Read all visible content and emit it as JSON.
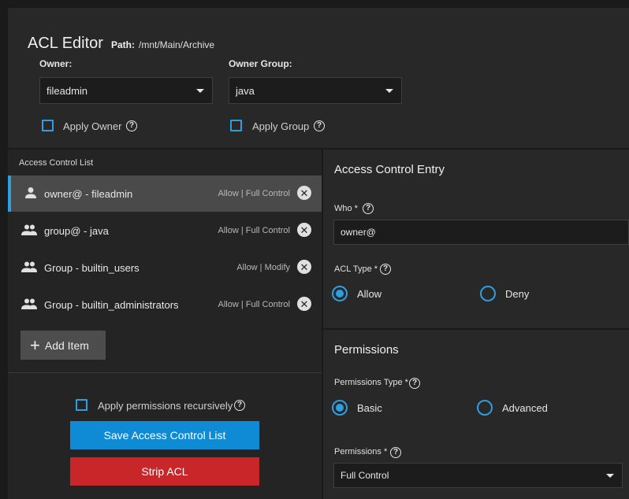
{
  "header": {
    "title": "ACL Editor",
    "path_label": "Path:",
    "path_value": "/mnt/Main/Archive"
  },
  "owner": {
    "label": "Owner:",
    "value": "fileadmin",
    "apply_label": "Apply Owner"
  },
  "owner_group": {
    "label": "Owner Group:",
    "value": "java",
    "apply_label": "Apply Group"
  },
  "acl_list": {
    "title": "Access Control List",
    "items": [
      {
        "icon": "person-icon",
        "name": "owner@ - fileadmin",
        "perm": "Allow | Full Control",
        "selected": true
      },
      {
        "icon": "group-icon",
        "name": "group@ - java",
        "perm": "Allow | Full Control",
        "selected": false
      },
      {
        "icon": "group-icon",
        "name": "Group - builtin_users",
        "perm": "Allow | Modify",
        "selected": false
      },
      {
        "icon": "group-icon",
        "name": "Group - builtin_administrators",
        "perm": "Allow | Full Control",
        "selected": false
      }
    ],
    "add_label": "Add Item"
  },
  "actions": {
    "recursive_label": "Apply permissions recursively",
    "save_label": "Save Access Control List",
    "strip_label": "Strip ACL"
  },
  "entry": {
    "title": "Access Control Entry",
    "who_label": "Who *",
    "who_value": "owner@",
    "acl_type_label": "ACL Type *",
    "allow_label": "Allow",
    "deny_label": "Deny",
    "selected_type": "Allow"
  },
  "permissions": {
    "title": "Permissions",
    "type_label": "Permissions Type *",
    "basic_label": "Basic",
    "advanced_label": "Advanced",
    "selected_type": "Basic",
    "perm_label": "Permissions *",
    "perm_value": "Full Control"
  },
  "colors": {
    "accent": "#2d9ee0",
    "save": "#0f8ad4",
    "strip": "#c9262a"
  }
}
